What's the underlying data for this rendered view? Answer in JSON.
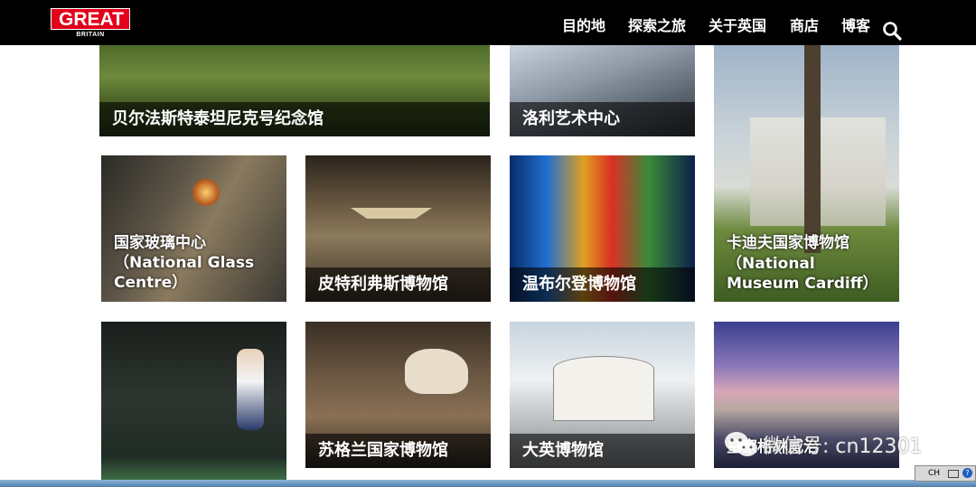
{
  "brand": {
    "logo_main": "GREAT",
    "logo_sub": "BRITAIN",
    "brand_red": "#e2001a"
  },
  "nav": {
    "items": [
      "目的地",
      "探索之旅",
      "关于英国",
      "商店",
      "博客"
    ],
    "search_icon": "search-icon"
  },
  "tiles": [
    {
      "caption": "贝尔法斯特泰坦尼克号纪念馆"
    },
    {
      "caption": "洛利艺术中心"
    },
    {
      "caption": "卡迪夫国家博物馆",
      "caption_en": "（National Museum Cardiff）"
    },
    {
      "caption": "国家玻璃中心",
      "caption_en": "（National Glass Centre）"
    },
    {
      "caption": "皮特利弗斯博物馆"
    },
    {
      "caption": "温布尔登博物馆"
    },
    {
      "caption": ""
    },
    {
      "caption": "苏格兰国家博物馆"
    },
    {
      "caption": "大英博物馆"
    },
    {
      "caption": "皇家格林威治"
    }
  ],
  "watermark": {
    "text": "微信号: cn12301"
  },
  "taskbar": {
    "lang": "CH"
  }
}
